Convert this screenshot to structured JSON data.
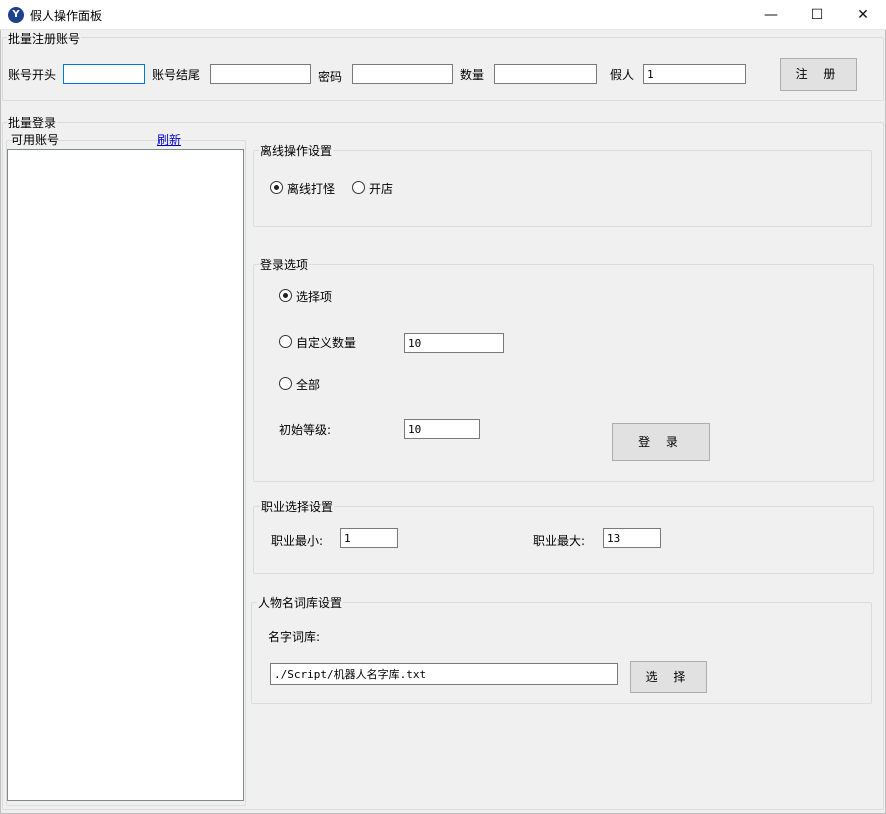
{
  "window": {
    "title": "假人操作面板",
    "minimize": "—",
    "maximize": "☐",
    "close": "✕"
  },
  "register": {
    "group_title": "批量注册账号",
    "start_label": "账号开头",
    "start_value": "",
    "end_label": "账号结尾",
    "end_value": "",
    "password_label": "密码",
    "password_value": "",
    "count_label": "数量",
    "count_value": "",
    "fake_label": "假人",
    "fake_value": "1",
    "register_button": "注 册"
  },
  "login": {
    "group_title": "批量登录",
    "accounts_label": "可用账号",
    "refresh_link": "刷新",
    "accounts": []
  },
  "offline": {
    "group_title": "离线操作设置",
    "options": [
      {
        "label": "离线打怪",
        "checked": true
      },
      {
        "label": "开店",
        "checked": false
      }
    ]
  },
  "login_options": {
    "group_title": "登录选项",
    "select_option": {
      "label": "选择项",
      "checked": true
    },
    "custom_option": {
      "label": "自定义数量",
      "checked": false
    },
    "custom_value": "10",
    "all_option": {
      "label": "全部",
      "checked": false
    },
    "initial_level_label": "初始等级:",
    "initial_level_value": "10",
    "login_button": "登 录"
  },
  "career": {
    "group_title": "职业选择设置",
    "min_label": "职业最小:",
    "min_value": "1",
    "max_label": "职业最大:",
    "max_value": "13"
  },
  "names": {
    "group_title": "人物名词库设置",
    "lib_label": "名字词库:",
    "path_value": "./Script/机器人名字库.txt",
    "select_button": "选 择"
  }
}
